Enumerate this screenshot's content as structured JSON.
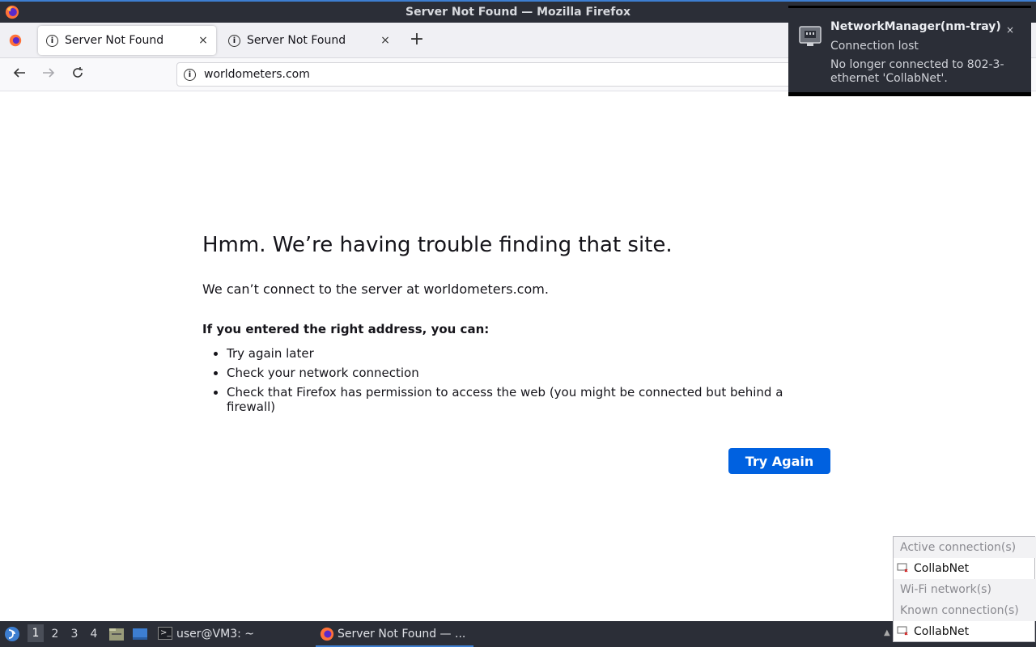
{
  "window": {
    "title": "Server Not Found — Mozilla Firefox"
  },
  "tabs": [
    {
      "label": "Server Not Found",
      "active": true
    },
    {
      "label": "Server Not Found",
      "active": false
    }
  ],
  "tab_close_glyph": "×",
  "new_tab_glyph": "+",
  "navbar": {
    "url": "worldometers.com"
  },
  "error_page": {
    "heading": "Hmm. We’re having trouble finding that site.",
    "message": "We can’t connect to the server at worldometers.com.",
    "suggestion_title": "If you entered the right address, you can:",
    "suggestions": [
      "Try again later",
      "Check your network connection",
      "Check that Firefox has permission to access the web (you might be connected but behind a firewall)"
    ],
    "try_again_label": "Try Again"
  },
  "notification": {
    "app": "NetworkManager(nm-tray)",
    "summary": "Connection lost",
    "body": "No longer connected to 802-3-ethernet 'CollabNet'.",
    "close_glyph": "×"
  },
  "taskbar": {
    "workspaces": [
      "1",
      "2",
      "3",
      "4"
    ],
    "active_workspace": "1",
    "terminal_label": "user@VM3: ~",
    "firefox_label": "Server Not Found — ..."
  },
  "tray_menu": {
    "active_header": "Active connection(s)",
    "active_item": "CollabNet",
    "wifi_header": "Wi-Fi network(s)",
    "known_header": "Known connection(s)",
    "known_item": "CollabNet"
  },
  "colors": {
    "accent": "#0061e0",
    "titlebar": "#2b2e37",
    "taskbar": "#2b2e37"
  }
}
